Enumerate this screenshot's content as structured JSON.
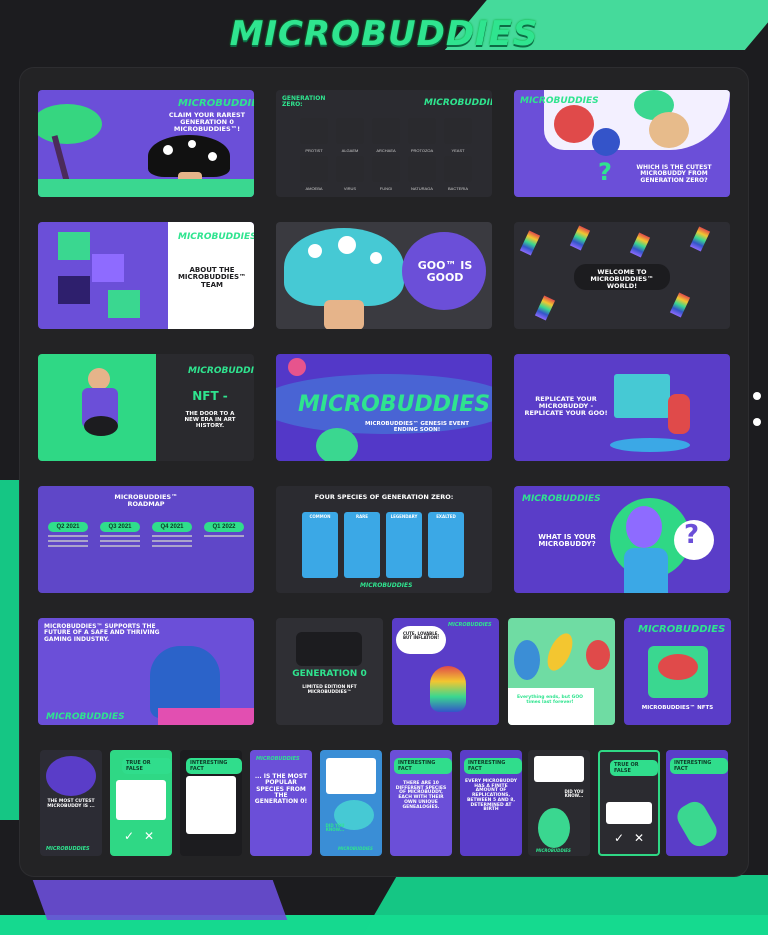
{
  "brand": {
    "logo": "MICROBUDDIES"
  },
  "cards": {
    "c1": {
      "logo": "MICROBUDDIES",
      "title": "CLAIM YOUR RAREST GENERATION 0 MICROBUDDIES™!"
    },
    "c2": {
      "heading": "GENERATION ZERO:",
      "logo": "MICROBUDDIES",
      "species": [
        "PROTIST",
        "ALGAEM",
        "ARCHAEA",
        "PROTOZOA",
        "YEAST",
        "AMOEBA",
        "VIRUS",
        "FUNGI",
        "NATURAGA",
        "BACTERIA"
      ]
    },
    "c3": {
      "logo": "MICROBUDDIES",
      "title": "WHICH IS THE CUTEST MICROBUDDY FROM GENERATION ZERO?"
    },
    "c4": {
      "logo": "MICROBUDDIES",
      "title": "ABOUT THE MICROBUDDIES™ TEAM"
    },
    "c5": {
      "title": "GOO™ IS GOOD"
    },
    "c6": {
      "title": "WELCOME TO MICROBUDDIES™ WORLD!"
    },
    "c7": {
      "logo": "MICROBUDDIES",
      "title": "NFT -",
      "subtitle": "THE DOOR TO A NEW ERA IN ART HISTORY."
    },
    "c8": {
      "logo": "MICROBUDDIES",
      "subtitle": "MICROBUDDIES™ GENESIS EVENT ENDING SOON!"
    },
    "c9": {
      "title": "REPLICATE YOUR MICROBUDDY - REPLICATE YOUR GOO!"
    },
    "c10": {
      "title": "MICROBUDDIES™ ROADMAP",
      "quarters": [
        "Q2 2021",
        "Q3 2021",
        "Q4 2021",
        "Q1 2022"
      ]
    },
    "c11": {
      "title": "FOUR SPECIES OF GENERATION ZERO:",
      "groups": [
        "COMMON",
        "RARE",
        "LEGENDARY",
        "EXALTED"
      ],
      "logo": "MICROBUDDIES"
    },
    "c12": {
      "logo": "MICROBUDDIES",
      "title": "WHAT IS YOUR MICROBUDDY?"
    },
    "c13": {
      "title": "MICROBUDDIES™ SUPPORTS THE FUTURE OF A SAFE AND THRIVING GAMING INDUSTRY.",
      "logo": "MICROBUDDIES"
    },
    "c14": {
      "title": "GENERATION 0",
      "subtitle": "LIMITED EDITION NFT MICROBUDDIES™"
    },
    "c15": {
      "bubble": "CUTE, LOVABLE, BUT INFLATION!",
      "logo": "MICROBUDDIES"
    },
    "c16": {
      "caption": "Everything ends, but GOO times last forever!"
    },
    "c17": {
      "logo": "MICROBUDDIES",
      "title": "MICROBUDDIES™ NFTS"
    },
    "s1": {
      "title": "THE MOST CUTEST MICROBUDDY IS ...",
      "logo": "MICROBUDDIES"
    },
    "s2": {
      "tag": "TRUE OR FALSE"
    },
    "s3": {
      "tag": "INTERESTING FACT"
    },
    "s4": {
      "logo": "MICROBUDDIES",
      "title": "... IS THE MOST POPULAR SPECIES FROM THE GENERATION 0!"
    },
    "s5": {
      "title": "DID YOU KNOW...",
      "logo": "MICROBUDDIES"
    },
    "s6": {
      "tag": "INTERESTING FACT",
      "title": "THERE ARE 10 DIFFERENT SPECIES OF MICROBUDDY, EACH WITH THEIR OWN UNIQUE GENEALOGIES."
    },
    "s7": {
      "tag": "INTERESTING FACT",
      "title": "EVERY MICROBUDDY HAS A FINITE AMOUNT OF REPLICATIONS, BETWEEN 5 AND 8, DETERMINED AT BIRTH"
    },
    "s8": {
      "title": "DID YOU KNOW...",
      "logo": "MICROBUDDIES"
    },
    "s9": {
      "tag": "TRUE OR FALSE"
    },
    "s10": {
      "tag": "INTERESTING FACT"
    }
  },
  "colors": {
    "green": "#2fe48f",
    "purple": "#6b4fd8",
    "dark": "#232325",
    "accent": "#15d98f"
  }
}
